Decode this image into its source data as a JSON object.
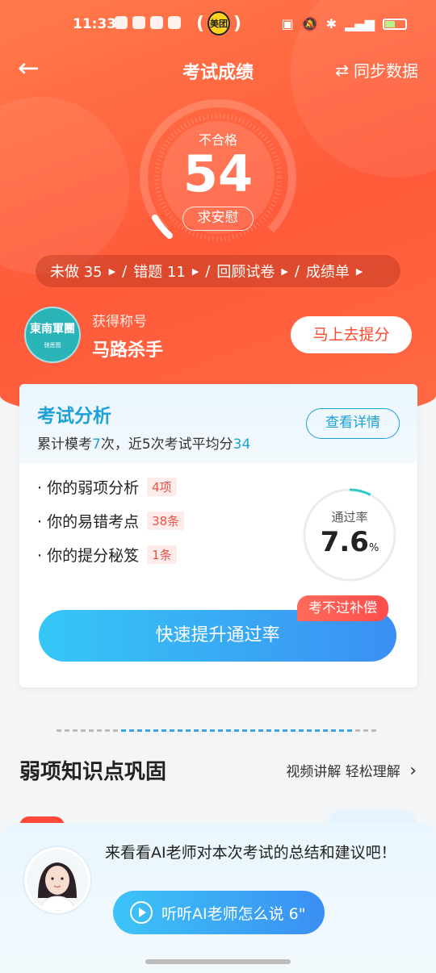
{
  "status_bar": {
    "time": "11:33"
  },
  "nav": {
    "title": "考试成绩",
    "sync_label": "同步数据"
  },
  "score": {
    "result_label": "不合格",
    "value": "54",
    "comfort_label": "求安慰"
  },
  "quick_links": [
    {
      "label": "未做 35"
    },
    {
      "label": "错题  11"
    },
    {
      "label": "回顾试卷"
    },
    {
      "label": "成绩单"
    }
  ],
  "title_badge": {
    "logo_text": "東南軍團",
    "logo_sub": "驰思图",
    "label": "获得称号",
    "value": "马路杀手",
    "button": "马上去提分"
  },
  "analysis": {
    "title": "考试分析",
    "summary_prefix": "累计模考",
    "mock_count": "7",
    "summary_mid": "次，近5次考试平均分",
    "avg_score": "34",
    "detail_button": "查看详情",
    "items": [
      {
        "label": "· 你的弱项分析",
        "tag": "4项"
      },
      {
        "label": "· 你的易错考点",
        "tag": "38条"
      },
      {
        "label": "· 你的提分秘笈",
        "tag": "1条"
      }
    ],
    "pass_rate_label": "通过率",
    "pass_rate_value": "7.6",
    "pass_rate_unit": "%",
    "boost_button": "快速提升通过率",
    "compensate_tag": "考不过补偿"
  },
  "weak_section": {
    "title": "弱项知识点巩固",
    "link": "视频讲解 轻松理解"
  },
  "ai": {
    "message": "来看看AI老师对本次考试的总结和建议吧！",
    "button": "听听AI老师怎么说 6\""
  },
  "colors": {
    "accent_orange": "#ff5a3a",
    "accent_blue": "#1da1d6",
    "fail_tag": "#e8534a"
  }
}
